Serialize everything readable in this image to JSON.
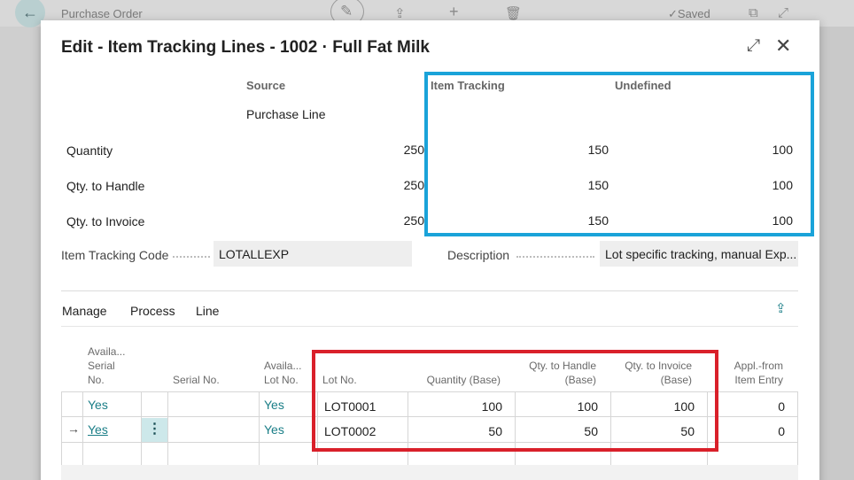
{
  "background": {
    "page_title": "Purchase Order",
    "saved_label": "Saved"
  },
  "dialog": {
    "title": "Edit - Item Tracking Lines - 1002 · Full Fat Milk",
    "summary": {
      "col_source": "Source",
      "col_item_tracking": "Item Tracking",
      "col_undefined": "Undefined",
      "source_type": "Purchase Line",
      "rows": [
        {
          "label": "Quantity",
          "source": "250",
          "tracking": "150",
          "undefined": "100"
        },
        {
          "label": "Qty. to Handle",
          "source": "250",
          "tracking": "150",
          "undefined": "100"
        },
        {
          "label": "Qty. to Invoice",
          "source": "250",
          "tracking": "150",
          "undefined": "100"
        }
      ]
    },
    "item_tracking_code_label": "Item Tracking Code",
    "item_tracking_code_value": "LOTALLEXP",
    "description_label": "Description",
    "description_value": "Lot specific tracking, manual Exp...",
    "menu": [
      "Manage",
      "Process",
      "Line"
    ],
    "table": {
      "headers": {
        "avail_serial": [
          "Availa...",
          "Serial",
          "No."
        ],
        "serial_no": "Serial No.",
        "avail_lot": [
          "Availa...",
          "Lot No."
        ],
        "lot_no": "Lot No.",
        "quantity_base": "Quantity (Base)",
        "qty_handle": [
          "Qty. to Handle",
          "(Base)"
        ],
        "qty_invoice": [
          "Qty. to Invoice",
          "(Base)"
        ],
        "appl_from": [
          "Appl.-from",
          "Item Entry"
        ]
      },
      "rows": [
        {
          "avail_serial": "Yes",
          "serial_no": "",
          "avail_lot": "Yes",
          "lot_no": "LOT0001",
          "quantity_base": "100",
          "qty_handle": "100",
          "qty_invoice": "100",
          "appl_from": "0"
        },
        {
          "avail_serial": "Yes",
          "serial_no": "",
          "avail_lot": "Yes",
          "lot_no": "LOT0002",
          "quantity_base": "50",
          "qty_handle": "50",
          "qty_invoice": "50",
          "appl_from": "0"
        }
      ]
    }
  },
  "colors": {
    "highlight_blue": "#1aa3d9",
    "highlight_red": "#d9202a",
    "accent_teal": "#1a7e87"
  }
}
